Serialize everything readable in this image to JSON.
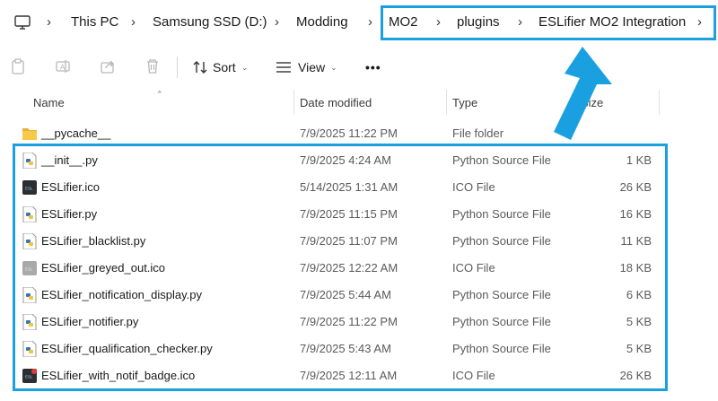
{
  "breadcrumb": {
    "items": [
      "This PC",
      "Samsung SSD (D:)",
      "Modding",
      "MO2",
      "plugins",
      "ESLifier MO2 Integration"
    ]
  },
  "toolbar": {
    "sort_label": "Sort",
    "view_label": "View",
    "more_label": "•••"
  },
  "columns": {
    "name": "Name",
    "date": "Date modified",
    "type": "Type",
    "size": "Size"
  },
  "files": [
    {
      "name": "__pycache__",
      "date": "7/9/2025 11:22 PM",
      "type": "File folder",
      "size": "",
      "icon": "folder-icon"
    },
    {
      "name": "__init__.py",
      "date": "7/9/2025 4:24 AM",
      "type": "Python Source File",
      "size": "1 KB",
      "icon": "python-file-icon"
    },
    {
      "name": "ESLifier.ico",
      "date": "5/14/2025 1:31 AM",
      "type": "ICO File",
      "size": "26 KB",
      "icon": "ico-dark-icon"
    },
    {
      "name": "ESLifier.py",
      "date": "7/9/2025 11:15 PM",
      "type": "Python Source File",
      "size": "16 KB",
      "icon": "python-file-icon"
    },
    {
      "name": "ESLifier_blacklist.py",
      "date": "7/9/2025 11:07 PM",
      "type": "Python Source File",
      "size": "11 KB",
      "icon": "python-file-icon"
    },
    {
      "name": "ESLifier_greyed_out.ico",
      "date": "7/9/2025 12:22 AM",
      "type": "ICO File",
      "size": "18 KB",
      "icon": "ico-grey-icon"
    },
    {
      "name": "ESLifier_notification_display.py",
      "date": "7/9/2025 5:44 AM",
      "type": "Python Source File",
      "size": "6 KB",
      "icon": "python-file-icon"
    },
    {
      "name": "ESLifier_notifier.py",
      "date": "7/9/2025 11:22 PM",
      "type": "Python Source File",
      "size": "5 KB",
      "icon": "python-file-icon"
    },
    {
      "name": "ESLifier_qualification_checker.py",
      "date": "7/9/2025 5:43 AM",
      "type": "Python Source File",
      "size": "5 KB",
      "icon": "python-file-icon"
    },
    {
      "name": "ESLifier_with_notif_badge.ico",
      "date": "7/9/2025 12:11 AM",
      "type": "ICO File",
      "size": "26 KB",
      "icon": "ico-badge-icon"
    }
  ],
  "colors": {
    "highlight": "#1aa0e0",
    "folder": "#f7c948",
    "python_blue": "#3a75b0",
    "python_yellow": "#f2c53d"
  }
}
